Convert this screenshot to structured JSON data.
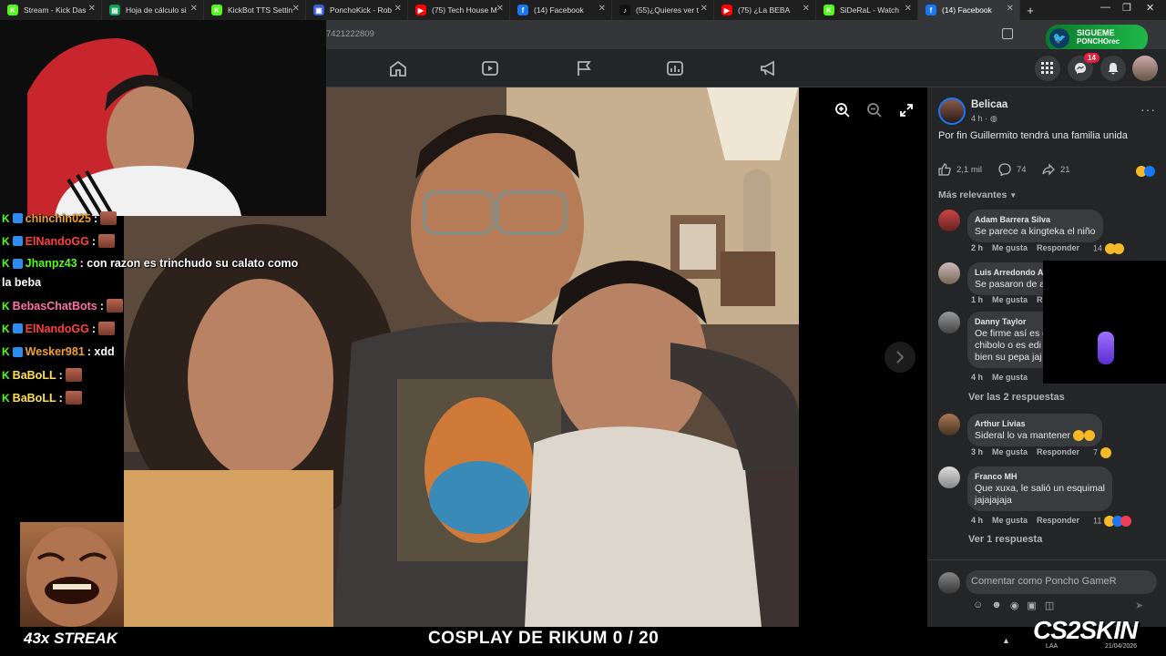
{
  "browser": {
    "tabs": [
      {
        "title": "Stream - Kick Das",
        "fav": "K",
        "color": "#53fc18"
      },
      {
        "title": "Hoja de cálculo si",
        "fav": "▤",
        "color": "#0f9d58"
      },
      {
        "title": "KickBot TTS Settin",
        "fav": "K",
        "color": "#53fc18"
      },
      {
        "title": "PonchoKick - Rob",
        "fav": "▣",
        "color": "#3b5bdb"
      },
      {
        "title": "(75) Tech House M",
        "fav": "▶",
        "color": "#ff0000"
      },
      {
        "title": "(14) Facebook",
        "fav": "f",
        "color": "#1877f2"
      },
      {
        "title": "(55)¿Quieres ver t",
        "fav": "♪",
        "color": "#111111"
      },
      {
        "title": "(75) ¿La BEBA",
        "fav": "▶",
        "color": "#ff0000"
      },
      {
        "title": "SiDeRaL - Watch",
        "fav": "K",
        "color": "#53fc18"
      },
      {
        "title": "(14) Facebook",
        "fav": "f",
        "color": "#1877f2"
      }
    ],
    "url_fragment": "7421222809",
    "siguenos_title": "SIGUEME",
    "siguenos_sub": "PONCHOrec"
  },
  "fb": {
    "notif_count": "14",
    "post": {
      "author": "Belicaa",
      "time": "4 h ·",
      "text": "Por fin Guillermito tendrá una familia unida",
      "likes": "2,1 mil",
      "comments": "74",
      "shares": "21",
      "filter": "Más relevantes"
    },
    "comments": [
      {
        "name": "Adam Barrera Silva",
        "text": "Se parece a kingteka el niño",
        "time": "2 h",
        "like": "Me gusta",
        "reply": "Responder",
        "reacts": "14"
      },
      {
        "name": "Luis Arredondo Av",
        "text": "Se pasaron de a",
        "time": "1 h",
        "like": "Me gusta",
        "reply": "R",
        "reacts": ""
      },
      {
        "name": "Danny Taylor",
        "text": "Oe firme así es e",
        "text2": "chibolo o es edi",
        "text3": "bien su pepa jaj",
        "time": "4 h",
        "like": "Me gusta",
        "reply": "",
        "reacts": ""
      },
      {
        "name": "Arthur Livias",
        "text": "Sideral lo va mantener",
        "time": "3 h",
        "like": "Me gusta",
        "reply": "Responder",
        "reacts": "7"
      },
      {
        "name": "Franco MH",
        "text": "Que xuxa, le salió un esquimal",
        "text2": "jajajajaja",
        "time": "4 h",
        "like": "Me gusta",
        "reply": "Responder",
        "reacts": "11"
      }
    ],
    "view_replies_1": "Ver las 2 respuestas",
    "view_replies_2": "Ver 1 respuesta",
    "comment_placeholder": "Comentar como Poncho GameR"
  },
  "chat": [
    {
      "user": "chinchin025",
      "msg": ":",
      "color": "#f0a030"
    },
    {
      "user": "ElNandoGG",
      "msg": ":",
      "color": "#ff4040"
    },
    {
      "user": "Jhanpz43",
      "msg": ": con razon es trinchudo su calato como",
      "color": "#53fc18"
    },
    {
      "user": "",
      "msg": "la beba",
      "color": "#ffffff"
    },
    {
      "user": "BebasChatBots",
      "msg": ":",
      "color": "#ff6fa8"
    },
    {
      "user": "ElNandoGG",
      "msg": ":",
      "color": "#ff4040"
    },
    {
      "user": "Wesker981",
      "msg": ": xdd",
      "color": "#f0a030"
    },
    {
      "user": "BaBoLL",
      "msg": ":",
      "color": "#ffe24a"
    },
    {
      "user": "BaBoLL",
      "msg": ":",
      "color": "#ffe24a"
    }
  ],
  "overlay": {
    "streak": "43x STREAK",
    "cosplay": "COSPLAY DE RIKUM 0 / 20",
    "cs_logo": "CS2SKIN",
    "clock_time": "LAA",
    "clock_date": "21/04/2026"
  },
  "colors": {
    "accent": "#1877f2",
    "kick": "#53fc18",
    "fbdark": "#242526"
  }
}
